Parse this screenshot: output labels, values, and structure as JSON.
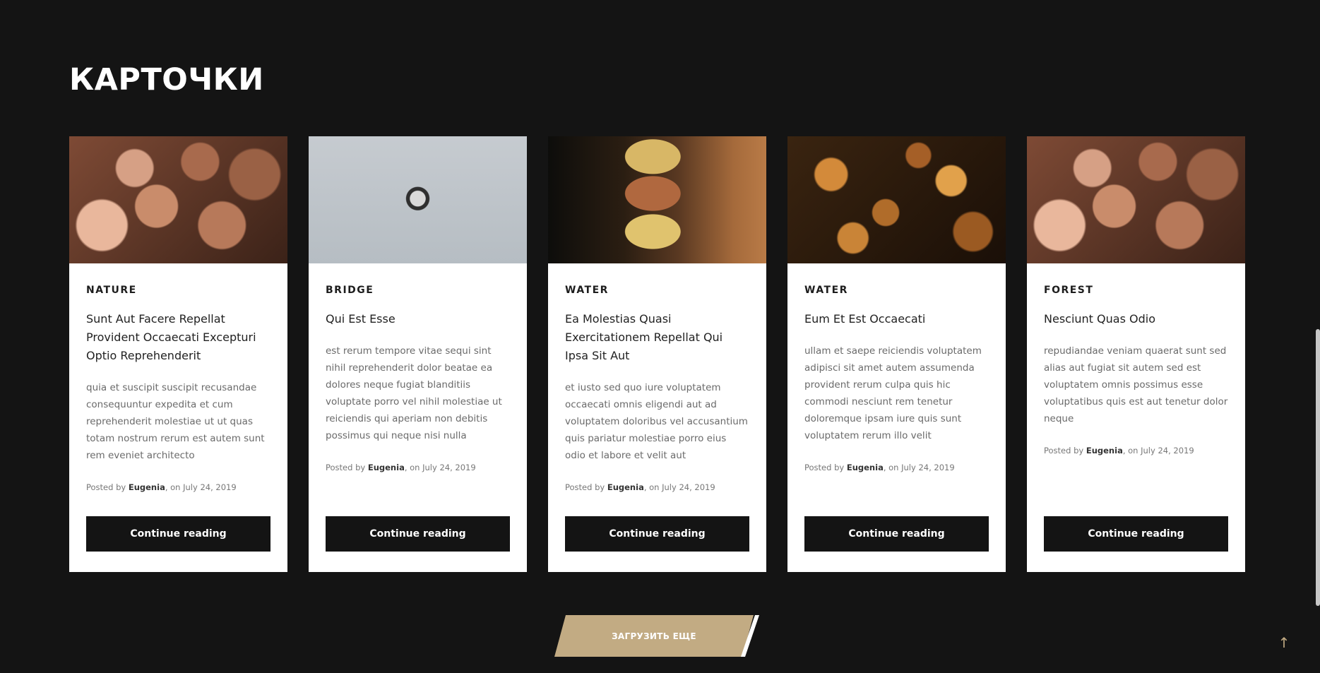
{
  "section": {
    "title": "КАРТОЧКИ"
  },
  "cards": [
    {
      "category": "NATURE",
      "title": "Sunt Aut Facere Repellat Provident Occaecati Excepturi Optio Reprehenderit",
      "excerpt": "quia et suscipit suscipit recusandae consequuntur expedita et cum reprehenderit molestiae ut ut quas totam nostrum rerum est autem sunt rem eveniet architecto",
      "meta_prefix": "Posted by ",
      "author": "Eugenia",
      "meta_suffix": ", on July 24, 2019",
      "button": "Continue reading",
      "image": "copper-coins-closeup"
    },
    {
      "category": "BRIDGE",
      "title": "Qui Est Esse",
      "excerpt": "est rerum tempore vitae sequi sint nihil reprehenderit dolor beatae ea dolores neque fugiat blanditiis voluptate porro vel nihil molestiae ut reiciendis qui aperiam non debitis possimus qui neque nisi nulla",
      "meta_prefix": "Posted by ",
      "author": "Eugenia",
      "meta_suffix": ", on July 24, 2019",
      "button": "Continue reading",
      "image": "single-coin-grey-background"
    },
    {
      "category": "WATER",
      "title": "Ea Molestias Quasi Exercitationem Repellat Qui Ipsa Sit Aut",
      "excerpt": "et iusto sed quo iure voluptatem occaecati omnis eligendi aut ad voluptatem doloribus vel accusantium quis pariatur molestiae porro eius odio et labore et velit aut",
      "meta_prefix": "Posted by ",
      "author": "Eugenia",
      "meta_suffix": ", on July 24, 2019",
      "button": "Continue reading",
      "image": "stacked-coins"
    },
    {
      "category": "WATER",
      "title": "Eum Et Est Occaecati",
      "excerpt": "ullam et saepe reiciendis voluptatem adipisci sit amet autem assumenda provident rerum culpa quis hic commodi nesciunt rem tenetur doloremque ipsam iure quis sunt voluptatem rerum illo velit",
      "meta_prefix": "Posted by ",
      "author": "Eugenia",
      "meta_suffix": ", on July 24, 2019",
      "button": "Continue reading",
      "image": "coin-pile"
    },
    {
      "category": "FOREST",
      "title": "Nesciunt Quas Odio",
      "excerpt": "repudiandae veniam quaerat sunt sed alias aut fugiat sit autem sed est voluptatem omnis possimus esse voluptatibus quis est aut tenetur dolor neque",
      "meta_prefix": "Posted by ",
      "author": "Eugenia",
      "meta_suffix": ", on July 24, 2019",
      "button": "Continue reading",
      "image": "copper-coins-closeup"
    }
  ],
  "load_more": {
    "label": "ЗАГРУЗИТЬ ЕЩЕ"
  },
  "scroll_top": {
    "icon": "arrow-up-icon",
    "glyph": "↑"
  },
  "colors": {
    "background": "#141414",
    "accent": "#c2ab83",
    "card": "#ffffff",
    "button": "#141414"
  }
}
